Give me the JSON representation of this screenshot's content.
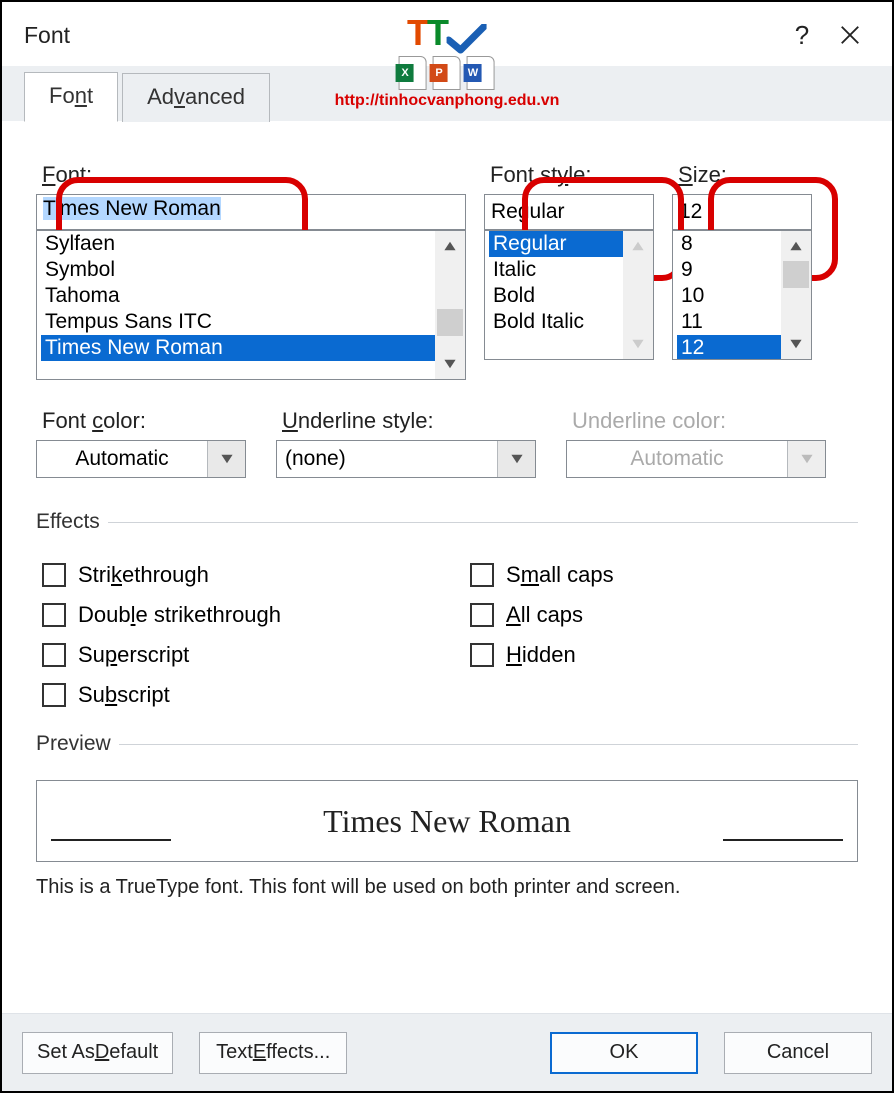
{
  "title": "Font",
  "watermark_url": "http://tinhocvanphong.edu.vn",
  "tabs": {
    "font": "Font",
    "advanced": "Advanced"
  },
  "font_section": {
    "label": "Font:",
    "value": "Times New Roman",
    "list": [
      "Sylfaen",
      "Symbol",
      "Tahoma",
      "Tempus Sans ITC",
      "Times New Roman"
    ],
    "selected": "Times New Roman"
  },
  "style_section": {
    "label": "Font style:",
    "value": "Regular",
    "list": [
      "Regular",
      "Italic",
      "Bold",
      "Bold Italic"
    ],
    "selected": "Regular"
  },
  "size_section": {
    "label": "Size:",
    "value": "12",
    "list": [
      "8",
      "9",
      "10",
      "11",
      "12"
    ],
    "selected": "12"
  },
  "color_row": {
    "font_color_label": "Font color:",
    "font_color_value": "Automatic",
    "underline_style_label": "Underline style:",
    "underline_style_value": "(none)",
    "underline_color_label": "Underline color:",
    "underline_color_value": "Automatic"
  },
  "effects": {
    "legend": "Effects",
    "strikethrough": "Strikethrough",
    "double_strikethrough": "Double strikethrough",
    "superscript": "Superscript",
    "subscript": "Subscript",
    "small_caps": "Small caps",
    "all_caps": "All caps",
    "hidden": "Hidden"
  },
  "preview": {
    "legend": "Preview",
    "sample": "Times New Roman",
    "note": "This is a TrueType font. This font will be used on both printer and screen."
  },
  "buttons": {
    "set_default": "Set As Default",
    "text_effects": "Text Effects...",
    "ok": "OK",
    "cancel": "Cancel"
  }
}
